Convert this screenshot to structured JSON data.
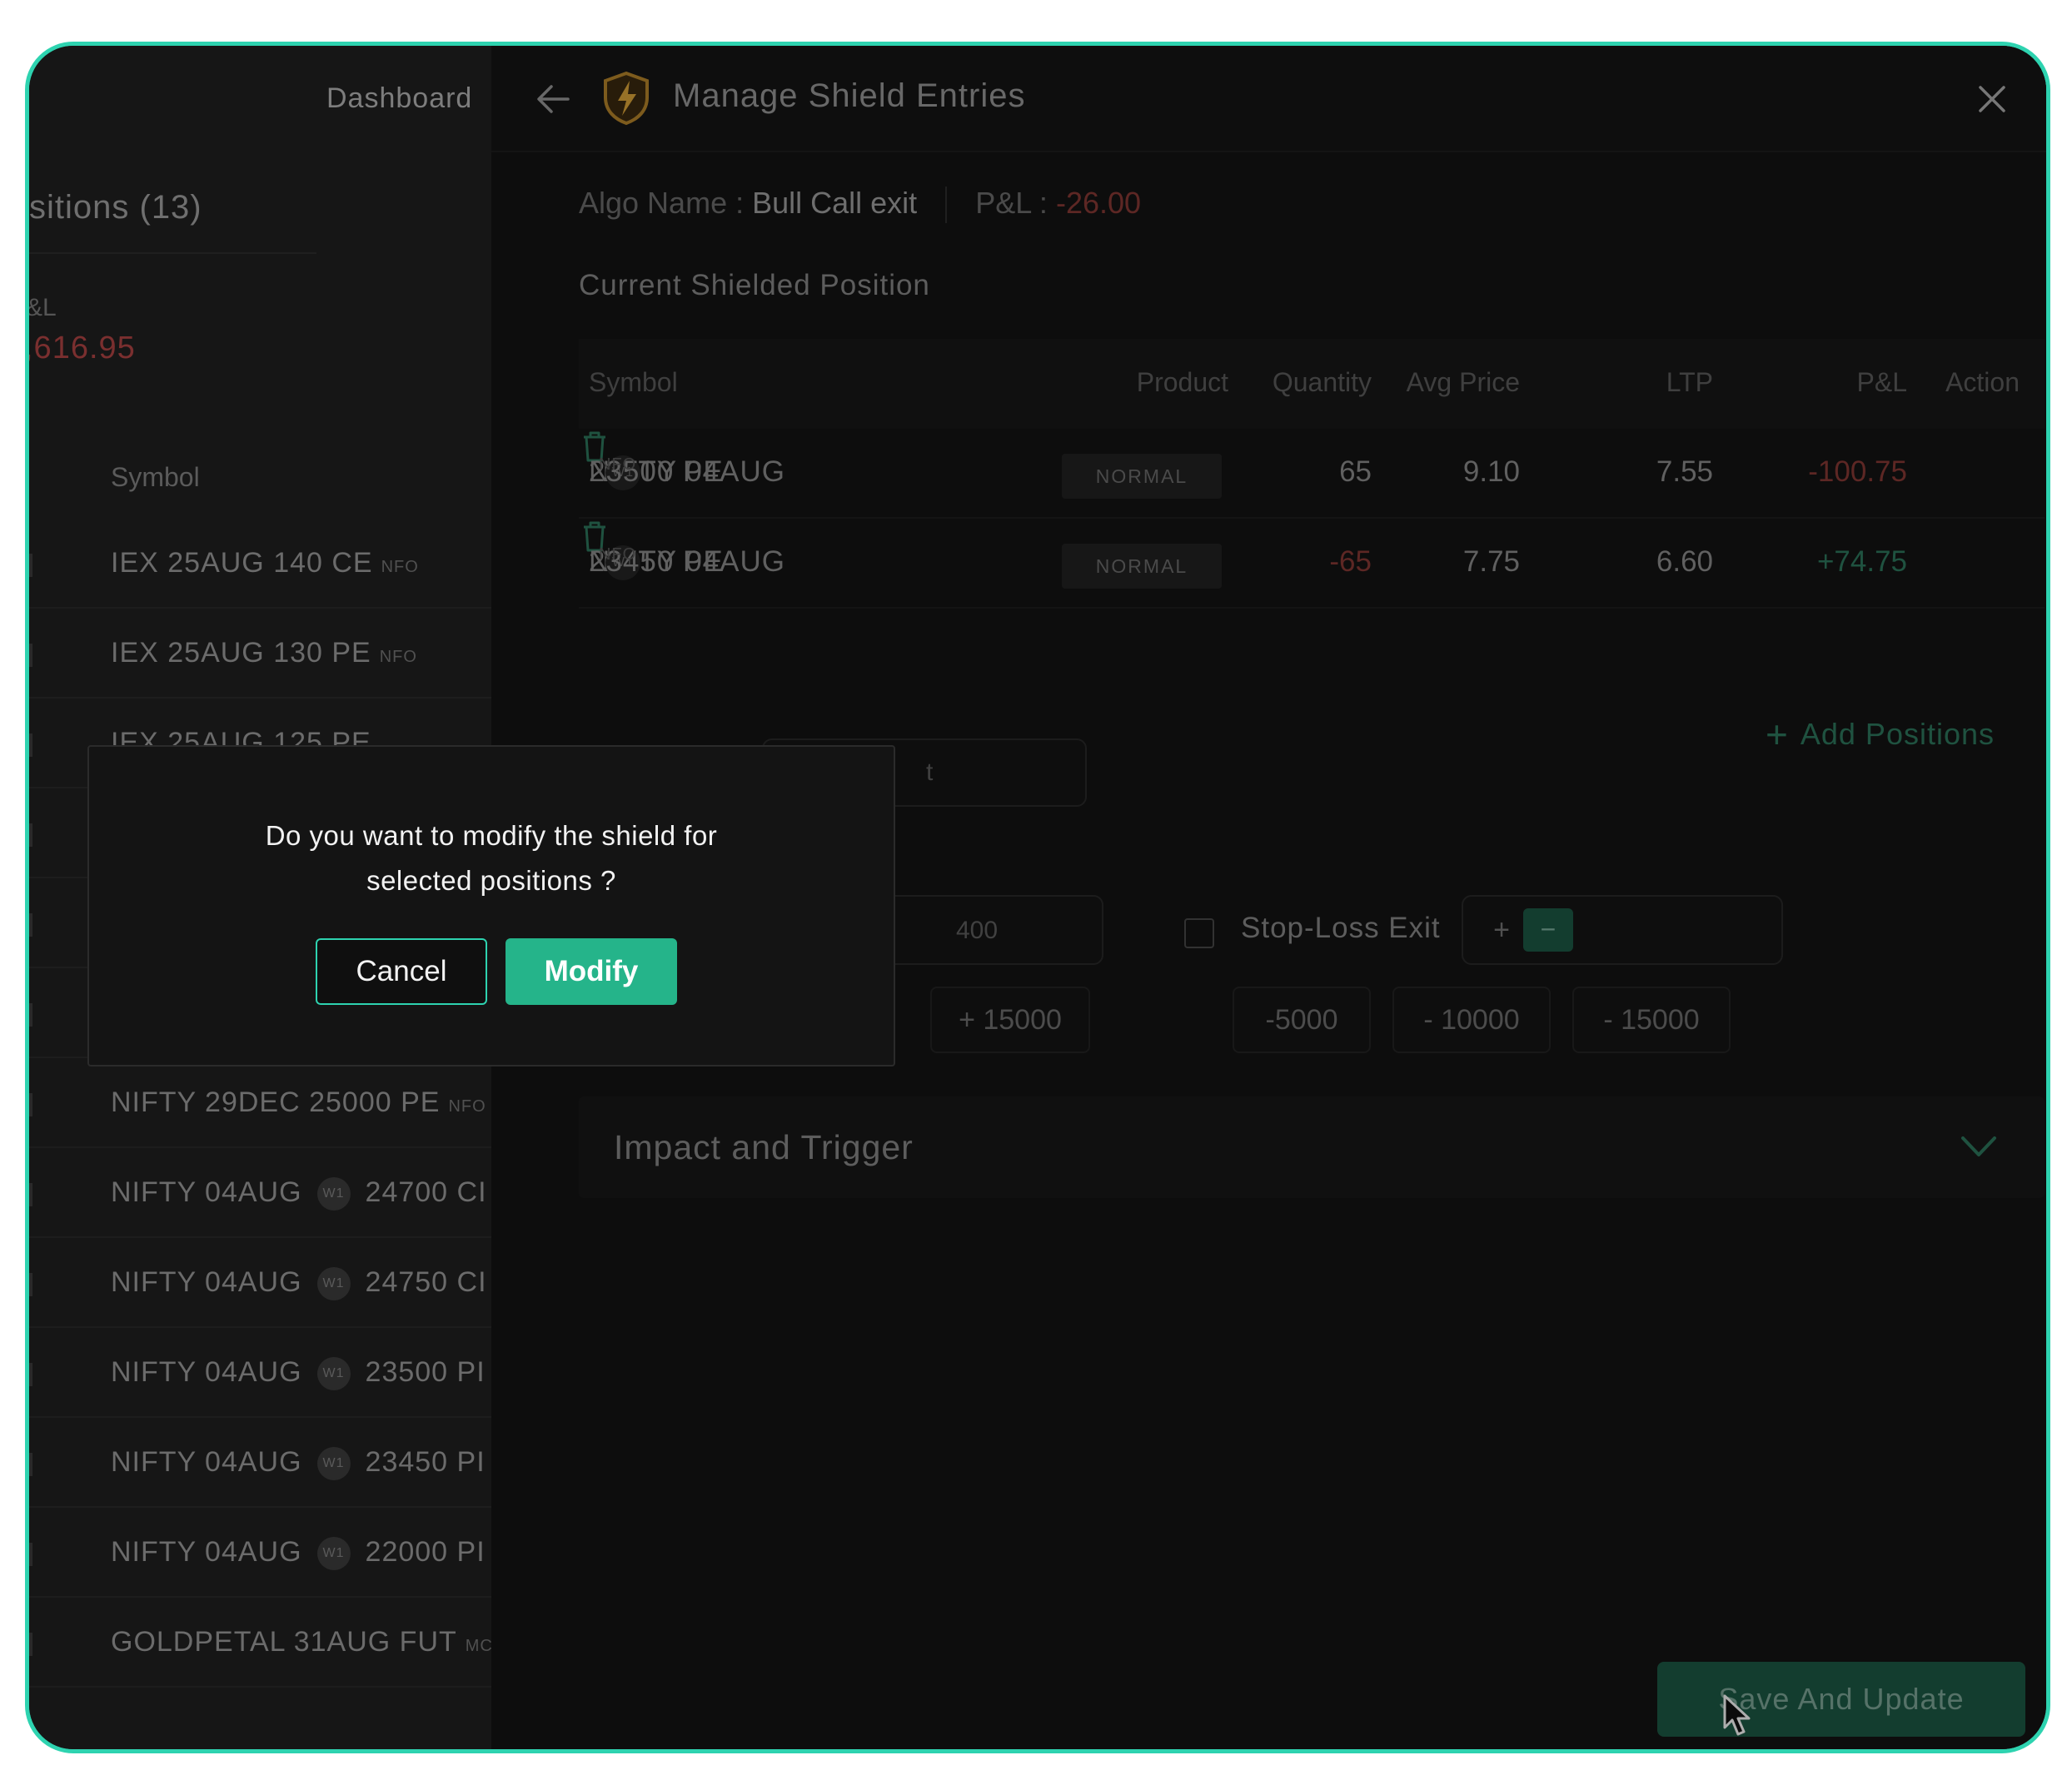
{
  "left_panel": {
    "dashboard_label": "Dashboard",
    "positions_title": "sitions (13)",
    "pl_label": "&L",
    "pl_value": ",616.95",
    "symbol_header": "Symbol",
    "rows": [
      {
        "symbol": "IEX 25AUG 140 CE",
        "exchange": "NFO"
      },
      {
        "symbol": "IEX 25AUG 130 PE",
        "exchange": "NFO"
      },
      {
        "symbol": "IEX 25AUG 125 PE",
        "exchange": ""
      },
      {
        "symbol": "NIFTY 29DEC 25000 PE",
        "exchange": "NFO"
      },
      {
        "symbol": "NIFTY 04AUG",
        "badge": "W1",
        "strike": "24700 CI"
      },
      {
        "symbol": "NIFTY 04AUG",
        "badge": "W1",
        "strike": "24750 CI"
      },
      {
        "symbol": "NIFTY 04AUG",
        "badge": "W1",
        "strike": "23500 PI"
      },
      {
        "symbol": "NIFTY 04AUG",
        "badge": "W1",
        "strike": "23450 PI"
      },
      {
        "symbol": "NIFTY 04AUG",
        "badge": "W1",
        "strike": "22000 PI"
      },
      {
        "symbol": "GOLDPETAL 31AUG FUT",
        "exchange": "MC"
      }
    ]
  },
  "header": {
    "title": "Manage Shield Entries"
  },
  "algo": {
    "name_label": "Algo Name :",
    "name_value": "Bull Call exit",
    "pl_label": "P&L :",
    "pl_value": "-26.00"
  },
  "section_title": "Current Shielded Position",
  "table": {
    "headers": {
      "symbol": "Symbol",
      "product": "Product",
      "quantity": "Quantity",
      "avg_price": "Avg Price",
      "ltp": "LTP",
      "pl": "P&L",
      "action": "Action"
    },
    "rows": [
      {
        "symbol": "NIFTY 04AUG",
        "badge": "W1",
        "strike": "23500 PE",
        "exchange": "NFO",
        "product": "NORMAL",
        "quantity": "65",
        "avg_price": "9.10",
        "ltp": "7.55",
        "pl": "-100.75"
      },
      {
        "symbol": "NIFTY 04AUG",
        "badge": "W1",
        "strike": "23450 PE",
        "exchange": "NFO",
        "product": "NORMAL",
        "quantity": "-65",
        "avg_price": "7.75",
        "ltp": "6.60",
        "pl": "+74.75"
      }
    ]
  },
  "add_positions": "Add Positions",
  "target": {
    "partial_label": "t",
    "input_value": "400",
    "chip_plus": "+ 15000"
  },
  "stop_loss": {
    "label": "Stop-Loss Exit",
    "plus": "+",
    "minus": "−",
    "chips": [
      "-5000",
      "- 10000",
      "- 15000"
    ]
  },
  "accordion": {
    "title": "Impact and Trigger"
  },
  "save_button": "Save And Update",
  "modal": {
    "message_line1": "Do you want to modify the shield for",
    "message_line2": "selected positions ?",
    "cancel": "Cancel",
    "modify": "Modify"
  },
  "colors": {
    "accent": "#25b48a",
    "frame": "#2ed3b0",
    "negative": "#8a3a36",
    "positive": "#2f7a5f"
  }
}
